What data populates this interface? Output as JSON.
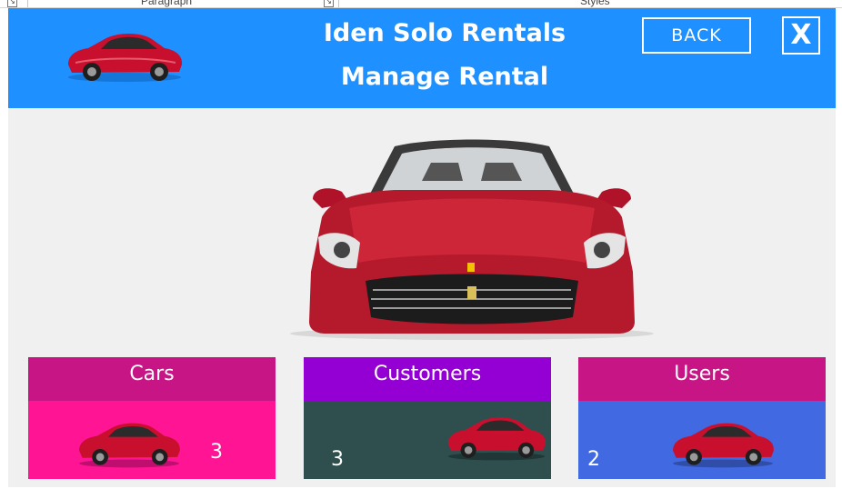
{
  "ribbon": {
    "left_label": "Paragraph",
    "right_label": "Styles"
  },
  "header": {
    "app_title": "Iden Solo Rentals",
    "page_title": "Manage Rental",
    "back_label": "BACK",
    "close_label": "X",
    "logo_icon": "red-sports-car-image",
    "background_color": "#1e90ff"
  },
  "hero": {
    "icon": "red-convertible-car-front-image"
  },
  "tiles": [
    {
      "title": "Cars",
      "count": "3",
      "head_color": "#c71585",
      "body_color": "#ff1493",
      "icon": "red-sports-car-image"
    },
    {
      "title": "Customers",
      "count": "3",
      "head_color": "#9400d3",
      "body_color": "#2f4f4f",
      "icon": "red-sports-car-image"
    },
    {
      "title": "Users",
      "count": "2",
      "head_color": "#c71585",
      "body_color": "#4169e1",
      "icon": "red-sports-car-image"
    }
  ]
}
